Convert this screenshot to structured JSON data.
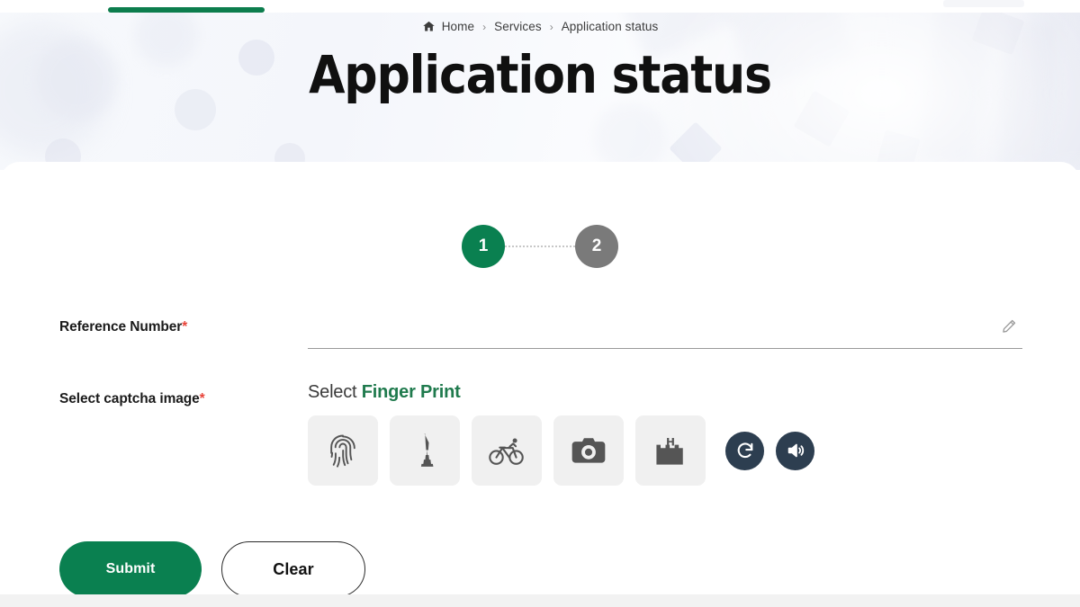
{
  "topbar": {
    "nav_indicator": "active-nav-underline"
  },
  "breadcrumb": {
    "home_icon": "home-icon",
    "items": [
      "Home",
      "Services",
      "Application status"
    ],
    "separator": "›"
  },
  "hero": {
    "title": "Application status"
  },
  "stepper": {
    "steps": [
      {
        "number": "1",
        "state": "active"
      },
      {
        "number": "2",
        "state": "inactive"
      }
    ]
  },
  "form": {
    "reference": {
      "label": "Reference Number",
      "required_mark": "*",
      "value": "",
      "placeholder": "",
      "edit_icon": "pencil-icon"
    },
    "captcha": {
      "label": "Select captcha image",
      "required_mark": "*",
      "prompt_prefix": "Select ",
      "prompt_target": "Finger Print",
      "tiles": [
        {
          "icon": "fingerprint-icon",
          "name": "fingerprint"
        },
        {
          "icon": "tower-icon",
          "name": "tower"
        },
        {
          "icon": "bicycle-icon",
          "name": "bicycle"
        },
        {
          "icon": "camera-icon",
          "name": "camera"
        },
        {
          "icon": "fort-icon",
          "name": "fort"
        }
      ],
      "refresh_icon": "refresh-icon",
      "audio_icon": "speaker-icon"
    }
  },
  "actions": {
    "submit_label": "Submit",
    "clear_label": "Clear"
  },
  "colors": {
    "brand_green": "#0a8050",
    "accent_green": "#1f7a4d",
    "required_red": "#e8443a",
    "navy": "#2d3e50",
    "step_inactive": "#7a7a7a",
    "tile_bg": "#f0f0f0"
  }
}
